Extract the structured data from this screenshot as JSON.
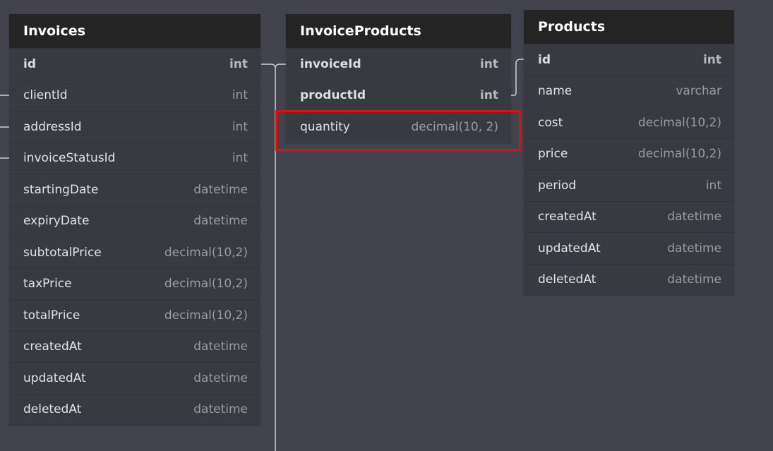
{
  "tables": {
    "invoices": {
      "title": "Invoices",
      "rows": [
        {
          "name": "id",
          "type": "int",
          "bold": true
        },
        {
          "name": "clientId",
          "type": "int"
        },
        {
          "name": "addressId",
          "type": "int"
        },
        {
          "name": "invoiceStatusId",
          "type": "int"
        },
        {
          "name": "startingDate",
          "type": "datetime"
        },
        {
          "name": "expiryDate",
          "type": "datetime"
        },
        {
          "name": "subtotalPrice",
          "type": "decimal(10,2)"
        },
        {
          "name": "taxPrice",
          "type": "decimal(10,2)"
        },
        {
          "name": "totalPrice",
          "type": "decimal(10,2)"
        },
        {
          "name": "createdAt",
          "type": "datetime"
        },
        {
          "name": "updatedAt",
          "type": "datetime"
        },
        {
          "name": "deletedAt",
          "type": "datetime"
        }
      ]
    },
    "invoiceproducts": {
      "title": "InvoiceProducts",
      "rows": [
        {
          "name": "invoiceId",
          "type": "int",
          "bold": true
        },
        {
          "name": "productId",
          "type": "int",
          "bold": true
        },
        {
          "name": "quantity",
          "type": "decimal(10, 2)"
        }
      ]
    },
    "products": {
      "title": "Products",
      "rows": [
        {
          "name": "id",
          "type": "int",
          "bold": true
        },
        {
          "name": "name",
          "type": "varchar"
        },
        {
          "name": "cost",
          "type": "decimal(10,2)"
        },
        {
          "name": "price",
          "type": "decimal(10,2)"
        },
        {
          "name": "period",
          "type": "int"
        },
        {
          "name": "createdAt",
          "type": "datetime"
        },
        {
          "name": "updatedAt",
          "type": "datetime"
        },
        {
          "name": "deletedAt",
          "type": "datetime"
        }
      ]
    }
  },
  "colors": {
    "canvas": "#43434e",
    "header": "#242424",
    "row": "#393941",
    "connector": "#d0d0d0",
    "highlight": "#e01010"
  }
}
